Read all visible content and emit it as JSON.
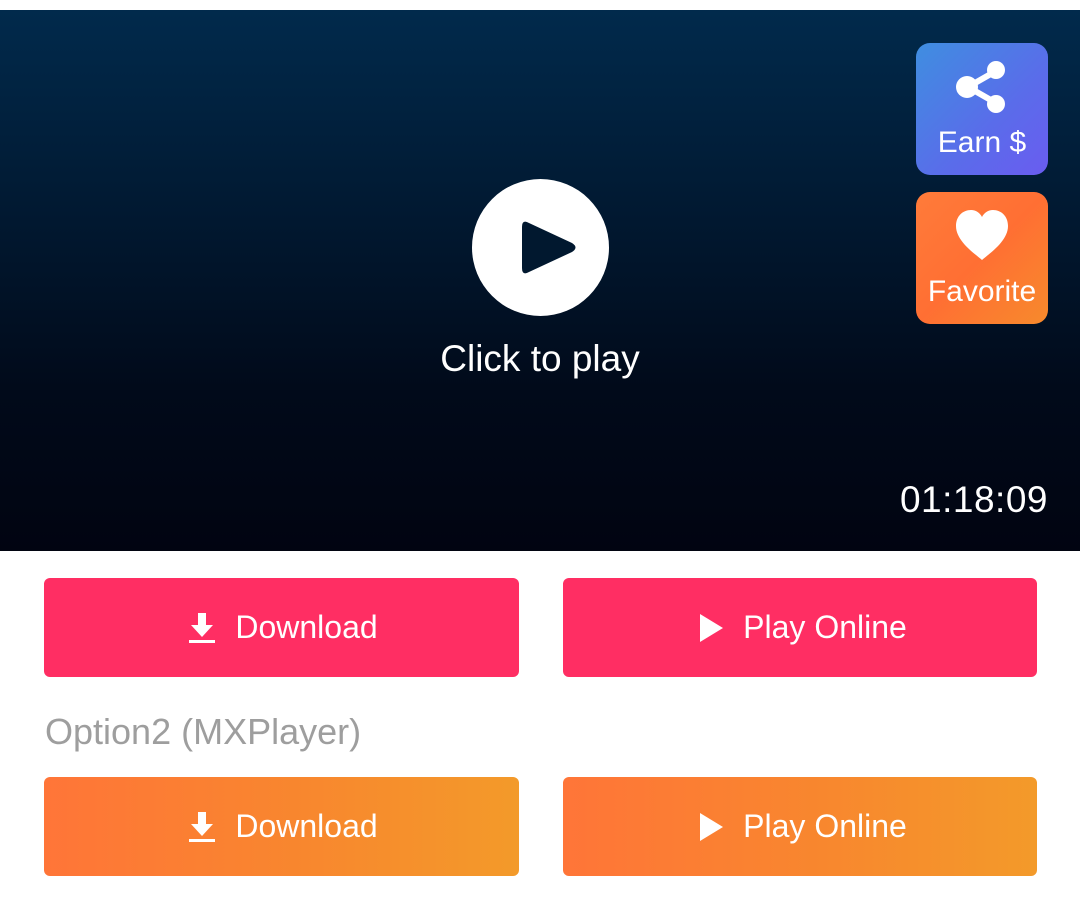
{
  "player": {
    "play_prompt": "Click to play",
    "duration": "01:18:09",
    "earn_label": "Earn $",
    "favorite_label": "Favorite"
  },
  "option1": {
    "download_label": "Download",
    "play_online_label": "Play Online"
  },
  "option2": {
    "title": "Option2 (MXPlayer)",
    "download_label": "Download",
    "play_online_label": "Play Online"
  },
  "colors": {
    "primary_button": "#ff2e63",
    "secondary_button": "#f8872e",
    "earn_button": "#5a6cea",
    "favorite_button": "#ff6f33",
    "player_background": "#011a33"
  }
}
